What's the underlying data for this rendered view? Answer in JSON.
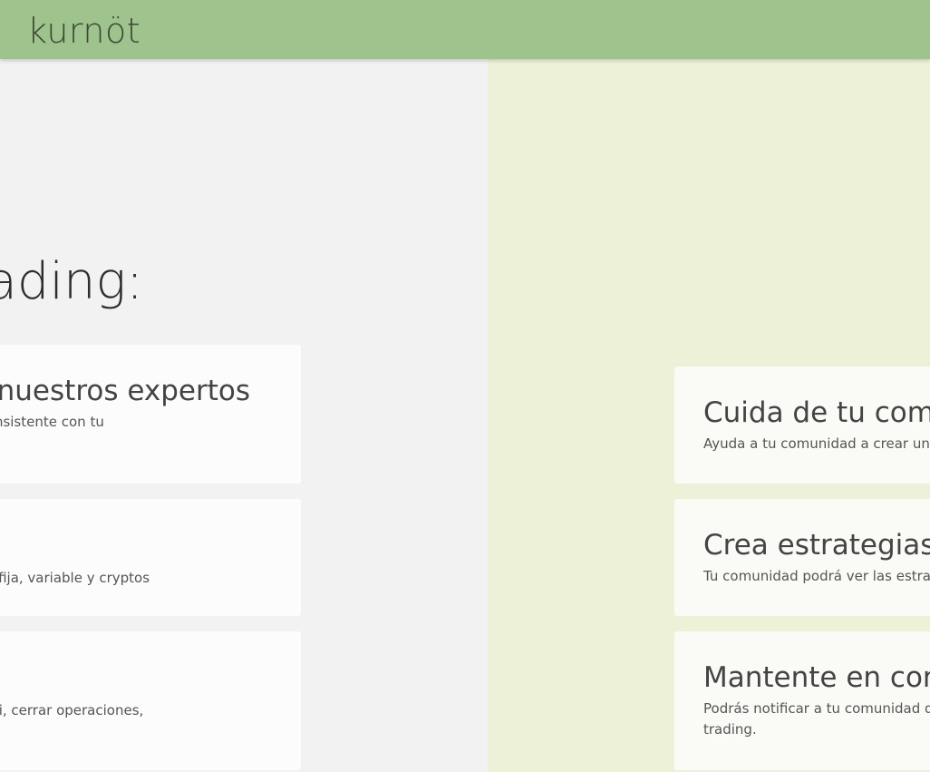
{
  "header": {
    "brand": "kurnöt"
  },
  "left": {
    "heading": "rading:",
    "cards": [
      {
        "title": "nuestros expertos",
        "text": "e aprendas a ser consistente con tu"
      },
      {
        "title": "",
        "text": "tradicional de renta fija, variable y cryptos"
      },
      {
        "title": "",
        "text": "emos procesos por ti, cerrar operaciones,"
      }
    ]
  },
  "right": {
    "cards": [
      {
        "title": "Cuida de tu com",
        "text": "Ayuda a tu comunidad a crear un p"
      },
      {
        "title": "Crea estrategias",
        "text": "Tu comunidad podrá ver las estrate"
      },
      {
        "title": "Mantente en cor",
        "text": "Podrás notificar a tu comunidad de de trading."
      }
    ]
  },
  "colors": {
    "header": "#9ec38c",
    "left_bg": "#f2f2f2",
    "right_bg": "#ecf1d7",
    "card_bg": "#fcfcfc"
  }
}
